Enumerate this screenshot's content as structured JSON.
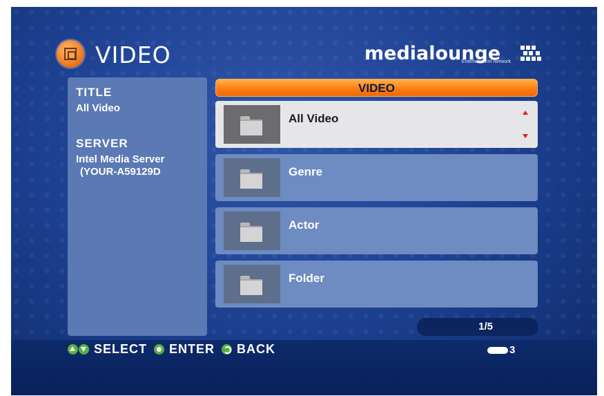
{
  "header": {
    "title": "VIDEO",
    "icon": "video-film-icon"
  },
  "logo": {
    "brand": "medialounge",
    "tagline": "Entertainment Network"
  },
  "info_panel": {
    "title_label": "TITLE",
    "title_value": "All Video",
    "server_label": "SERVER",
    "server_line1": "Intel Media Server",
    "server_line2": "(YOUR-A59129D"
  },
  "list": {
    "header": "VIDEO",
    "items": [
      {
        "label": "All Video",
        "icon": "folder-icon",
        "selected": true
      },
      {
        "label": "Genre",
        "icon": "folder-icon",
        "selected": false
      },
      {
        "label": "Actor",
        "icon": "folder-icon",
        "selected": false
      },
      {
        "label": "Folder",
        "icon": "folder-icon",
        "selected": false
      }
    ],
    "page_indicator": "1/5"
  },
  "footer": {
    "select_label": "SELECT",
    "enter_label": "ENTER",
    "back_label": "BACK",
    "status_count": "3"
  },
  "colors": {
    "background": "#1f4396",
    "accent": "#ff7a10",
    "panel": "#5b79b4",
    "selected_row": "#e6e6e8",
    "button_green": "#58b045",
    "scroll_arrow": "#e02020"
  }
}
